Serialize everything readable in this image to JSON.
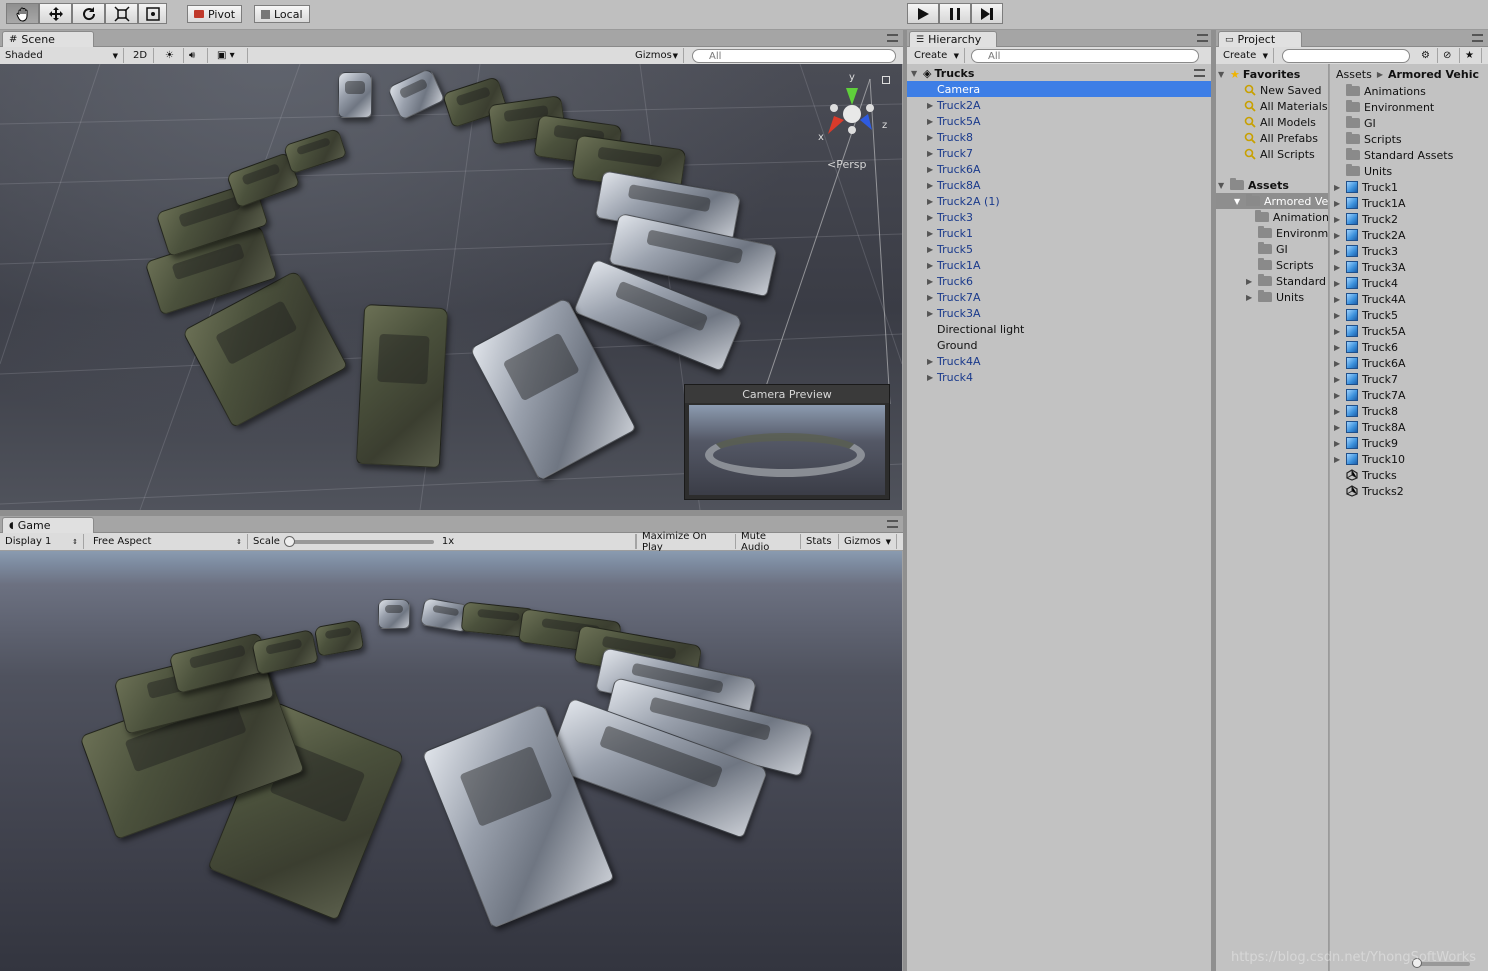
{
  "toolbar": {
    "tools": [
      "hand-tool",
      "move-tool",
      "rotate-tool",
      "scale-tool",
      "rect-tool"
    ],
    "pivot_label": "Pivot",
    "local_label": "Local"
  },
  "scene": {
    "tab_label": "Scene",
    "shading_mode": "Shaded",
    "mode_2d": "2D",
    "gizmos_label": "Gizmos",
    "search_placeholder": "All",
    "persp_label": "Persp",
    "axis_x": "x",
    "axis_y": "y",
    "axis_z": "z",
    "camera_preview_title": "Camera Preview"
  },
  "game": {
    "tab_label": "Game",
    "display": "Display 1",
    "aspect": "Free Aspect",
    "scale_label": "Scale",
    "scale_value": "1x",
    "maximize_on_play": "Maximize On Play",
    "mute_audio": "Mute Audio",
    "stats": "Stats",
    "gizmos_label": "Gizmos"
  },
  "hierarchy": {
    "tab_label": "Hierarchy",
    "create_label": "Create",
    "search_placeholder": "All",
    "scene_name": "Trucks",
    "items": [
      {
        "label": "Camera",
        "prefab": false,
        "expandable": false,
        "selected": true
      },
      {
        "label": "Truck2A",
        "prefab": true,
        "expandable": true,
        "selected": false
      },
      {
        "label": "Truck5A",
        "prefab": true,
        "expandable": true,
        "selected": false
      },
      {
        "label": "Truck8",
        "prefab": true,
        "expandable": true,
        "selected": false
      },
      {
        "label": "Truck7",
        "prefab": true,
        "expandable": true,
        "selected": false
      },
      {
        "label": "Truck6A",
        "prefab": true,
        "expandable": true,
        "selected": false
      },
      {
        "label": "Truck8A",
        "prefab": true,
        "expandable": true,
        "selected": false
      },
      {
        "label": "Truck2A (1)",
        "prefab": true,
        "expandable": true,
        "selected": false
      },
      {
        "label": "Truck3",
        "prefab": true,
        "expandable": true,
        "selected": false
      },
      {
        "label": "Truck1",
        "prefab": true,
        "expandable": true,
        "selected": false
      },
      {
        "label": "Truck5",
        "prefab": true,
        "expandable": true,
        "selected": false
      },
      {
        "label": "Truck1A",
        "prefab": true,
        "expandable": true,
        "selected": false
      },
      {
        "label": "Truck6",
        "prefab": true,
        "expandable": true,
        "selected": false
      },
      {
        "label": "Truck7A",
        "prefab": true,
        "expandable": true,
        "selected": false
      },
      {
        "label": "Truck3A",
        "prefab": true,
        "expandable": true,
        "selected": false
      },
      {
        "label": "Directional light",
        "prefab": false,
        "expandable": false,
        "selected": false
      },
      {
        "label": "Ground",
        "prefab": false,
        "expandable": false,
        "selected": false
      },
      {
        "label": "Truck4A",
        "prefab": true,
        "expandable": true,
        "selected": false
      },
      {
        "label": "Truck4",
        "prefab": true,
        "expandable": true,
        "selected": false
      }
    ]
  },
  "project": {
    "tab_label": "Project",
    "create_label": "Create",
    "favorites_label": "Favorites",
    "favorites": [
      "New Saved",
      "All Materials",
      "All Models",
      "All Prefabs",
      "All Scripts"
    ],
    "assets_label": "Assets",
    "assets_tree": [
      {
        "label": "Armored Ve",
        "depth": 1,
        "selected": true,
        "arrow": "down"
      },
      {
        "label": "Animation",
        "depth": 2,
        "selected": false,
        "arrow": ""
      },
      {
        "label": "Environm",
        "depth": 2,
        "selected": false,
        "arrow": ""
      },
      {
        "label": "GI",
        "depth": 2,
        "selected": false,
        "arrow": ""
      },
      {
        "label": "Scripts",
        "depth": 2,
        "selected": false,
        "arrow": ""
      },
      {
        "label": "Standard",
        "depth": 2,
        "selected": false,
        "arrow": "right"
      },
      {
        "label": "Units",
        "depth": 2,
        "selected": false,
        "arrow": "right"
      }
    ],
    "breadcrumb": [
      "Assets",
      "Armored Vehic"
    ],
    "contents": [
      {
        "label": "Animations",
        "kind": "folder"
      },
      {
        "label": "Environment",
        "kind": "folder"
      },
      {
        "label": "GI",
        "kind": "folder"
      },
      {
        "label": "Scripts",
        "kind": "folder"
      },
      {
        "label": "Standard Assets",
        "kind": "folder"
      },
      {
        "label": "Units",
        "kind": "folder"
      },
      {
        "label": "Truck1",
        "kind": "prefab"
      },
      {
        "label": "Truck1A",
        "kind": "prefab"
      },
      {
        "label": "Truck2",
        "kind": "prefab"
      },
      {
        "label": "Truck2A",
        "kind": "prefab"
      },
      {
        "label": "Truck3",
        "kind": "prefab"
      },
      {
        "label": "Truck3A",
        "kind": "prefab"
      },
      {
        "label": "Truck4",
        "kind": "prefab"
      },
      {
        "label": "Truck4A",
        "kind": "prefab"
      },
      {
        "label": "Truck5",
        "kind": "prefab"
      },
      {
        "label": "Truck5A",
        "kind": "prefab"
      },
      {
        "label": "Truck6",
        "kind": "prefab"
      },
      {
        "label": "Truck6A",
        "kind": "prefab"
      },
      {
        "label": "Truck7",
        "kind": "prefab"
      },
      {
        "label": "Truck7A",
        "kind": "prefab"
      },
      {
        "label": "Truck8",
        "kind": "prefab"
      },
      {
        "label": "Truck8A",
        "kind": "prefab"
      },
      {
        "label": "Truck9",
        "kind": "prefab"
      },
      {
        "label": "Truck10",
        "kind": "prefab"
      },
      {
        "label": "Trucks",
        "kind": "scene"
      },
      {
        "label": "Trucks2",
        "kind": "scene"
      }
    ]
  },
  "watermark": "https://blog.csdn.net/YhongSoftWorks"
}
